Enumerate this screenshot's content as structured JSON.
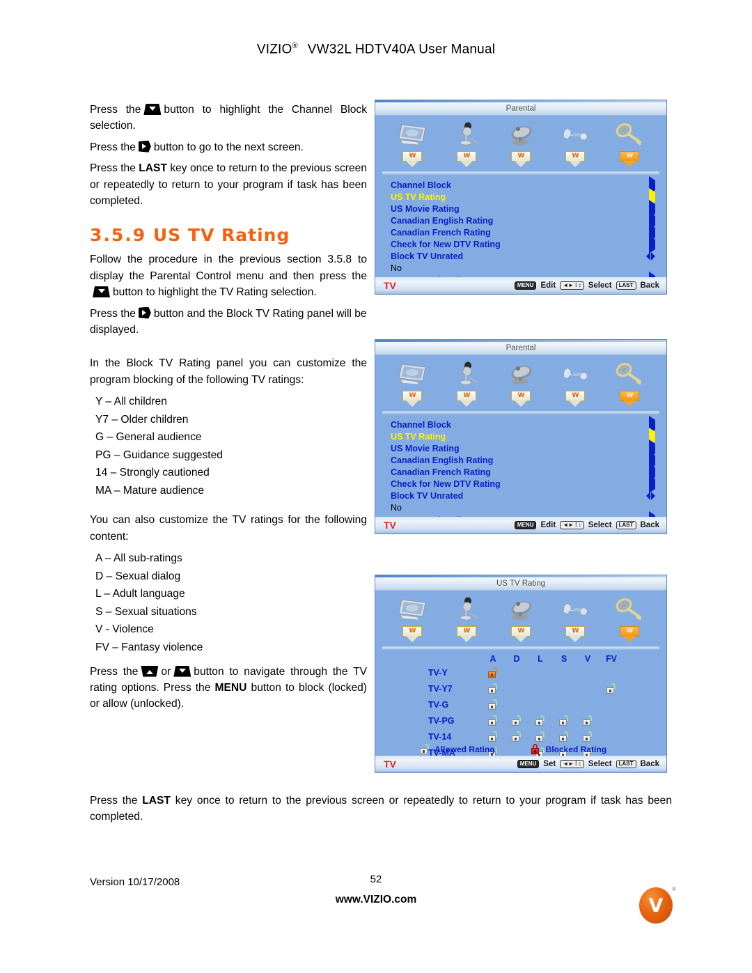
{
  "header": {
    "brand": "VIZIO",
    "registered": "®",
    "title": "VW32L HDTV40A User Manual"
  },
  "left_column": {
    "p1_a": "Press the",
    "p1_b": "button to highlight the Channel Block selection.",
    "p2_a": "Press the",
    "p2_b": "button to go to the next screen.",
    "p3_a": "Press the",
    "p3_key": "LAST",
    "p3_b": "key once to return to the previous screen or repeatedly to return to your program if task has been completed.",
    "section_number": "3.5.9",
    "section_title": "US TV Rating",
    "p4_a": "Follow the procedure in the previous section 3.5.8 to display the Parental Control menu and then press the",
    "p4_b": "button to highlight the TV Rating selection.",
    "p5_a": "Press the",
    "p5_b": "button and the Block TV Rating panel will be displayed.",
    "p6": "In the Block TV Rating panel you can customize the program blocking of the following TV ratings:",
    "tv_ratings": [
      "Y – All children",
      "Y7 – Older children",
      "G – General audience",
      "PG – Guidance suggested",
      "14 – Strongly cautioned",
      "MA – Mature audience"
    ],
    "p7": "You can also customize the TV ratings for the following content:",
    "content_ratings": [
      "A – All sub-ratings",
      "D – Sexual dialog",
      "L – Adult language",
      "S – Sexual situations",
      "V - Violence",
      "FV – Fantasy violence"
    ],
    "p8_a": "Press the",
    "p8_or": "or",
    "p8_b": "button to navigate through the TV rating options.  Press the",
    "p8_key": "MENU",
    "p8_c": "button to block (locked) or allow (unlocked)."
  },
  "bottom_paragraph": {
    "a": "Press the",
    "key": "LAST",
    "b": "key once to return to the previous screen or repeatedly to return to your program if task has been completed."
  },
  "footer": {
    "version": "Version 10/17/2008",
    "page_number": "52",
    "url": "www.VIZIO.com",
    "logo_letter": "V",
    "logo_mark": "®"
  },
  "osd_icons": [
    {
      "name": "tv-monitor-icon",
      "active": false
    },
    {
      "name": "microphone-icon",
      "active": false
    },
    {
      "name": "satellite-dish-icon",
      "active": false
    },
    {
      "name": "wrench-icon",
      "active": false
    },
    {
      "name": "key-icon",
      "active": true
    }
  ],
  "parental_menu": {
    "title": "Parental",
    "items": [
      {
        "label": "Channel Block",
        "value": "",
        "selected": false,
        "arrow": "right"
      },
      {
        "label": "US TV Rating",
        "value": "",
        "selected": true,
        "arrow": "right"
      },
      {
        "label": "US Movie Rating",
        "value": "",
        "selected": false,
        "arrow": "right"
      },
      {
        "label": "Canadian English Rating",
        "value": "",
        "selected": false,
        "arrow": "right"
      },
      {
        "label": "Canadian French Rating",
        "value": "",
        "selected": false,
        "arrow": "right"
      },
      {
        "label": "Check for New DTV Rating",
        "value": "",
        "selected": false,
        "arrow": "right"
      },
      {
        "label": "Block TV Unrated",
        "value": "No",
        "selected": false,
        "arrow": "leftright"
      },
      {
        "label": "Access Code Edit",
        "value": "",
        "selected": false,
        "arrow": "right"
      }
    ],
    "status": {
      "tv_tag": "TV",
      "menu_key": "MENU",
      "menu_action": "Edit",
      "nav_action": "Select",
      "last_key": "LAST",
      "last_action": "Back"
    }
  },
  "us_tv_rating": {
    "title": "US TV Rating",
    "columns": [
      "A",
      "D",
      "L",
      "S",
      "V",
      "FV"
    ],
    "rows": [
      {
        "label": "TV-Y",
        "cells": [
          "highlight",
          "",
          "",
          "",
          "",
          ""
        ]
      },
      {
        "label": "TV-Y7",
        "cells": [
          "allowed",
          "",
          "",
          "",
          "",
          "allowed"
        ]
      },
      {
        "label": "TV-G",
        "cells": [
          "allowed",
          "",
          "",
          "",
          "",
          ""
        ]
      },
      {
        "label": "TV-PG",
        "cells": [
          "allowed",
          "allowed",
          "allowed",
          "allowed",
          "allowed",
          ""
        ]
      },
      {
        "label": "TV-14",
        "cells": [
          "allowed",
          "allowed",
          "allowed",
          "allowed",
          "allowed",
          ""
        ]
      },
      {
        "label": "TV-MA",
        "cells": [
          "allowed",
          "",
          "allowed",
          "allowed",
          "allowed",
          ""
        ]
      }
    ],
    "legend": {
      "allowed": "Allowed Rating",
      "blocked": "Blocked Rating"
    },
    "status": {
      "tv_tag": "TV",
      "menu_key": "MENU",
      "menu_action": "Set",
      "nav_action": "Select",
      "last_key": "LAST",
      "last_action": "Back"
    }
  },
  "colors": {
    "osd_background": "#83ACE2",
    "osd_text": "#0A1FC8",
    "osd_selected": "#FFF000",
    "heading_orange": "#F4620F",
    "tv_tag_red": "#E02020",
    "logo_orange": "#E8640E"
  }
}
